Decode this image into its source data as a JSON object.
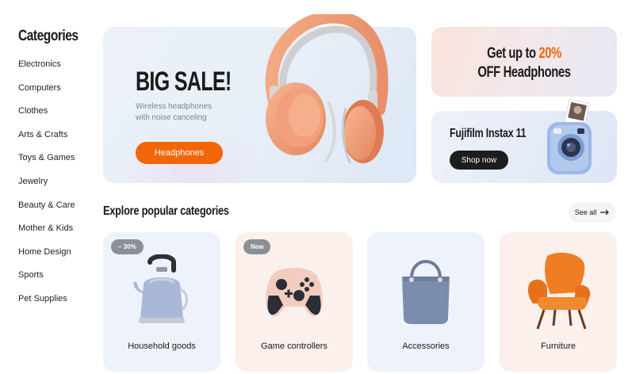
{
  "sidebar": {
    "title": "Categories",
    "items": [
      "Electronics",
      "Computers",
      "Clothes",
      "Arts & Crafts",
      "Toys & Games",
      "Jewelry",
      "Beauty & Care",
      "Mother & Kids",
      "Home Design",
      "Sports",
      "Pet Supplies"
    ]
  },
  "hero": {
    "title": "BIG SALE!",
    "subtitle_line1": "Wireless headphones",
    "subtitle_line2": "with noise canceling",
    "button_label": "Headphones"
  },
  "promo1": {
    "line1_prefix": "Get up to ",
    "line1_accent": "20%",
    "line2": "OFF Headphones"
  },
  "promo2": {
    "title": "Fujifilm Instax 11",
    "button_label": "Shop now"
  },
  "explore": {
    "title": "Explore popular categories",
    "see_all_label": "See all",
    "cards": [
      {
        "label": "Household goods",
        "badge": "– 30%"
      },
      {
        "label": "Game controllers",
        "badge": "New"
      },
      {
        "label": "Accessories",
        "badge": ""
      },
      {
        "label": "Furniture",
        "badge": ""
      }
    ]
  },
  "colors": {
    "accent": "#f2660a",
    "dark_button": "#1d1d1f",
    "card_blue": "#eef3fb",
    "card_peach": "#fbf0ec"
  },
  "icons": [
    "arrow-right-icon",
    "headphones-image",
    "instax-camera-image",
    "kettle-image",
    "game-controller-image",
    "tote-bag-image",
    "armchair-image"
  ]
}
